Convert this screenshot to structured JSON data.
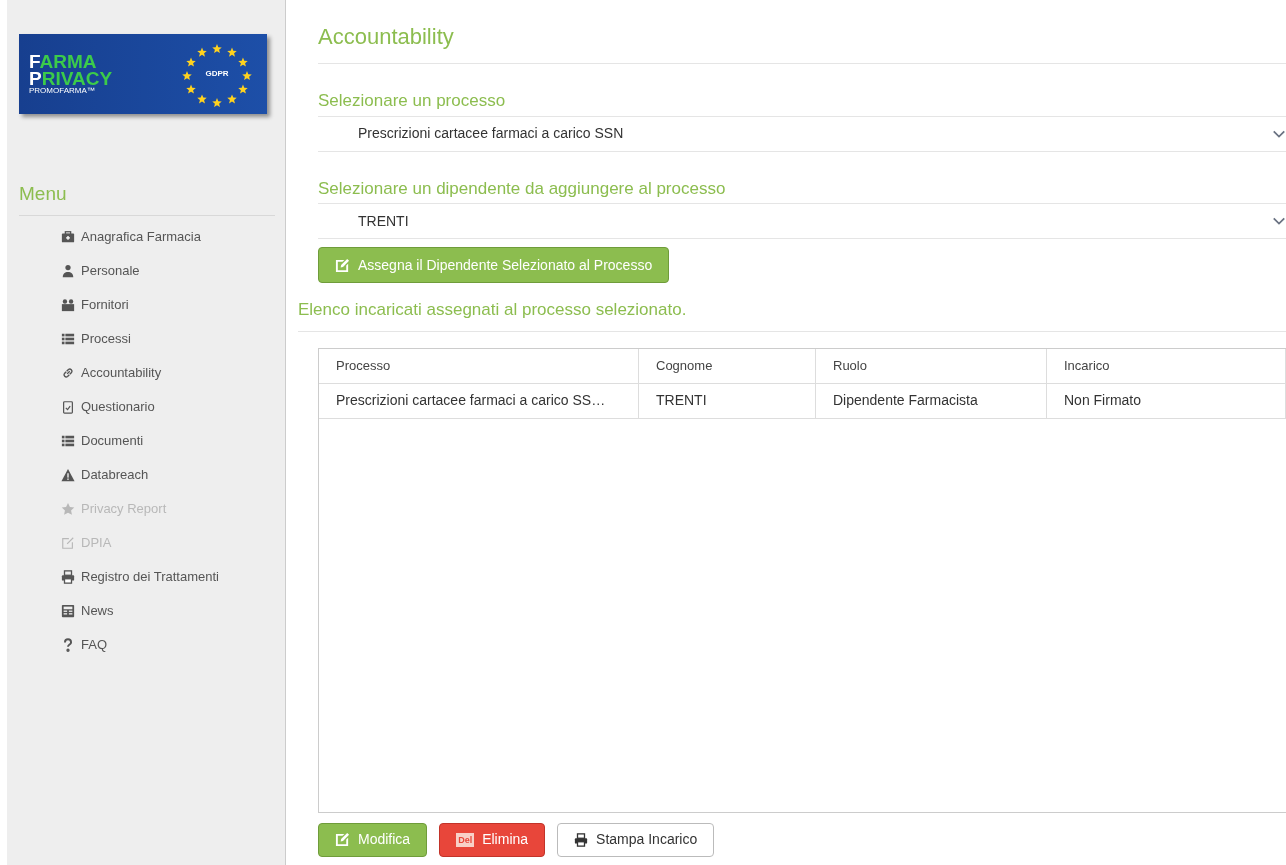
{
  "logo": {
    "line_1_initial": "F",
    "line_1_rest": "ARMA",
    "line_2_initial": "P",
    "line_2_rest": "RIVACY",
    "brand": "PROMOFARMA™",
    "badge": "GDPR"
  },
  "menu": {
    "title": "Menu",
    "items": [
      {
        "label": "Anagrafica Farmacia",
        "kind": "briefcase",
        "disabled": false
      },
      {
        "label": "Personale",
        "kind": "user",
        "disabled": false
      },
      {
        "label": "Fornitori",
        "kind": "users",
        "disabled": false
      },
      {
        "label": "Processi",
        "kind": "list",
        "disabled": false
      },
      {
        "label": "Accountability",
        "kind": "link",
        "disabled": false
      },
      {
        "label": "Questionario",
        "kind": "clipboard",
        "disabled": false
      },
      {
        "label": "Documenti",
        "kind": "list",
        "disabled": false
      },
      {
        "label": "Databreach",
        "kind": "warning",
        "disabled": false
      },
      {
        "label": "Privacy Report",
        "kind": "star",
        "disabled": true
      },
      {
        "label": "DPIA",
        "kind": "edit",
        "disabled": true
      },
      {
        "label": "Registro dei Trattamenti",
        "kind": "print",
        "disabled": false
      },
      {
        "label": "News",
        "kind": "news",
        "disabled": false
      },
      {
        "label": "FAQ",
        "kind": "question",
        "disabled": false
      }
    ]
  },
  "page_title": "Accountability",
  "process_select": {
    "label": "Selezionare un processo",
    "value": "Prescrizioni cartacee farmaci a carico SSN"
  },
  "employee_select": {
    "label": "Selezionare un dipendente da aggiungere al processo",
    "value": "TRENTI"
  },
  "assign_button": "Assegna il Dipendente Selezionato al Processo",
  "list_title": "Elenco incaricati assegnati al processo selezionato.",
  "table": {
    "columns": [
      "Processo",
      "Cognome",
      "Ruolo",
      "Incarico"
    ],
    "rows": [
      [
        "Prescrizioni cartacee farmaci a carico SS…",
        "TRENTI",
        "Dipendente Farmacista",
        "Non Firmato"
      ]
    ]
  },
  "actions": [
    {
      "label": "Modifica",
      "kind": "edit"
    },
    {
      "label": "Elimina",
      "kind": "delete",
      "icon_text": "Del"
    },
    {
      "label": "Stampa Incarico",
      "kind": "print"
    }
  ]
}
